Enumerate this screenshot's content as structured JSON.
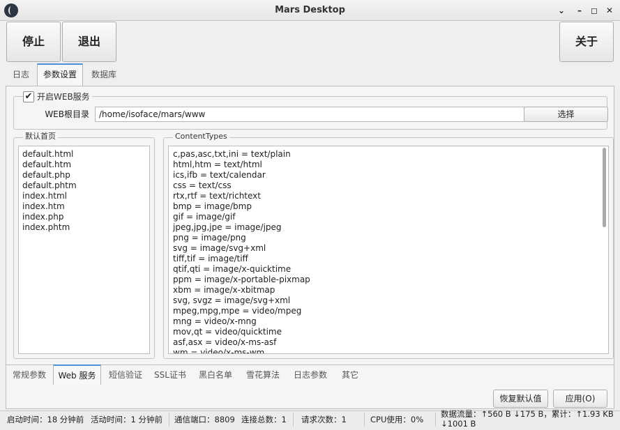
{
  "window": {
    "title": "Mars Desktop"
  },
  "toolbar": {
    "stop_label": "停止",
    "exit_label": "退出",
    "about_label": "关于"
  },
  "main_tabs": [
    "日志",
    "参数设置",
    "数据库"
  ],
  "web": {
    "enable_label": "开启WEB服务",
    "enabled": true,
    "root_label": "WEB根目录",
    "root_value": "/home/isoface/mars/www",
    "browse_label": "选择"
  },
  "default_pages": {
    "legend": "默认首页",
    "items": [
      "default.html",
      "default.htm",
      "default.php",
      "default.phtm",
      "index.html",
      "index.htm",
      "index.php",
      "index.phtm"
    ]
  },
  "content_types": {
    "legend": "ContentTypes",
    "items": [
      "c,pas,asc,txt,ini = text/plain",
      "html,htm = text/html",
      "ics,ifb = text/calendar",
      "css = text/css",
      "rtx,rtf = text/richtext",
      "bmp = image/bmp",
      "gif = image/gif",
      "jpeg,jpg,jpe = image/jpeg",
      "png = image/png",
      "svg = image/svg+xml",
      "tiff,tif = image/tiff",
      "qtif,qti = image/x-quicktime",
      "ppm = image/x-portable-pixmap",
      "xbm = image/x-xbitmap",
      "svg, svgz = image/svg+xml",
      "mpeg,mpg,mpe = video/mpeg",
      "mng = video/x-mng",
      "mov,qt = video/quicktime",
      "asf,asx = video/x-ms-asf",
      "wm = video/x-ms-wm"
    ]
  },
  "sub_tabs": [
    "常规参数",
    "Web 服务",
    "短信验证",
    "SSL证书",
    "黑白名单",
    "雪花算法",
    "日志参数",
    "其它"
  ],
  "actions": {
    "restore_label": "恢复默认值",
    "apply_label": "应用(O)"
  },
  "status": {
    "start_time": "启动时间：18 分钟前",
    "active_time": "活动时间：1 分钟前",
    "port": "通信端口：8809",
    "connections": "连接总数：1",
    "requests": "请求次数：1",
    "cpu": "CPU使用：0%",
    "traffic_line1": "数据流量：↑560 B ↓175 B，累计：↑1.93 KB",
    "traffic_line2": "↓1001 B"
  }
}
